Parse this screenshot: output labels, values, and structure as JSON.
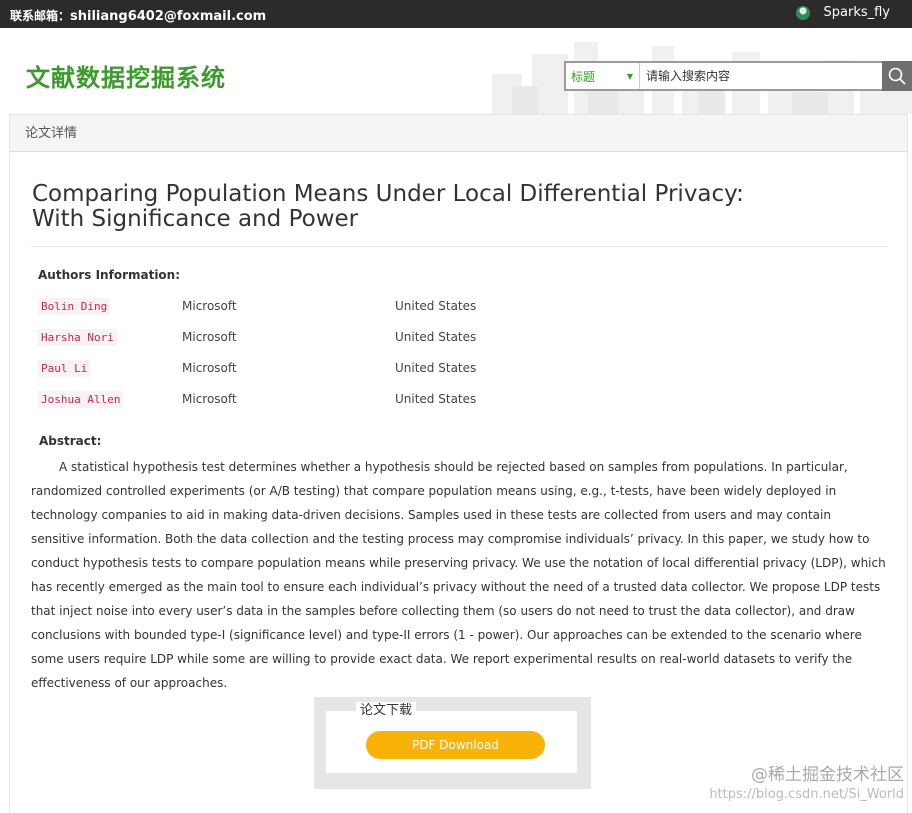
{
  "topbar": {
    "contact_label": "联系邮箱：",
    "contact_email": "shiliang6402@foxmail.com",
    "username": "Sparks_fly"
  },
  "header": {
    "logo_text": "文献数据挖掘系统",
    "search_scope": "标题",
    "search_placeholder": "请输入搜索内容"
  },
  "breadcrumb": "论文详情",
  "paper": {
    "title": "Comparing Population Means Under Local Differential Privacy: With Significance and Power",
    "authors_heading": "Authors Information:",
    "authors": [
      {
        "name": "Bolin Ding",
        "org": "Microsoft",
        "country": "United States"
      },
      {
        "name": "Harsha Nori",
        "org": "Microsoft",
        "country": "United States"
      },
      {
        "name": "Paul Li",
        "org": "Microsoft",
        "country": "United States"
      },
      {
        "name": "Joshua Allen",
        "org": "Microsoft",
        "country": "United States"
      }
    ],
    "abstract_heading": "Abstract:",
    "abstract": "A statistical hypothesis test determines whether a hypothesis should be rejected based on samples from populations. In particular, randomized controlled experiments (or A/B testing) that compare population means using, e.g., t-tests, have been widely deployed in technology companies to aid in making data-driven decisions. Samples used in these tests are collected from users and may contain sensitive information. Both the data collection and the testing process may compromise individuals’ privacy. In this paper, we study how to conduct hypothesis tests to compare population means while preserving privacy. We use the notation of local differential privacy (LDP), which has recently emerged as the main tool to ensure each individual’s privacy without the need of a trusted data collector. We propose LDP tests that inject noise into every user’s data in the samples before collecting them (so users do not need to trust the data collector), and draw conclusions with bounded type-I (significance level) and type-II errors (1 - power). Our approaches can be extended to the scenario where some users require LDP while some are willing to provide exact data. We report experimental results on real-world datasets to verify the effectiveness of our approaches."
  },
  "download": {
    "label": "论文下载",
    "button": "PDF  Download"
  },
  "watermark": {
    "brand": "@稀土掘金技术社区",
    "url": "https://blog.csdn.net/Si_World"
  },
  "colors": {
    "topbar_bg": "#2b2b2b",
    "logo": "#3c9a2e",
    "author_name": "#c7254e",
    "download_button": "#f8b208"
  }
}
